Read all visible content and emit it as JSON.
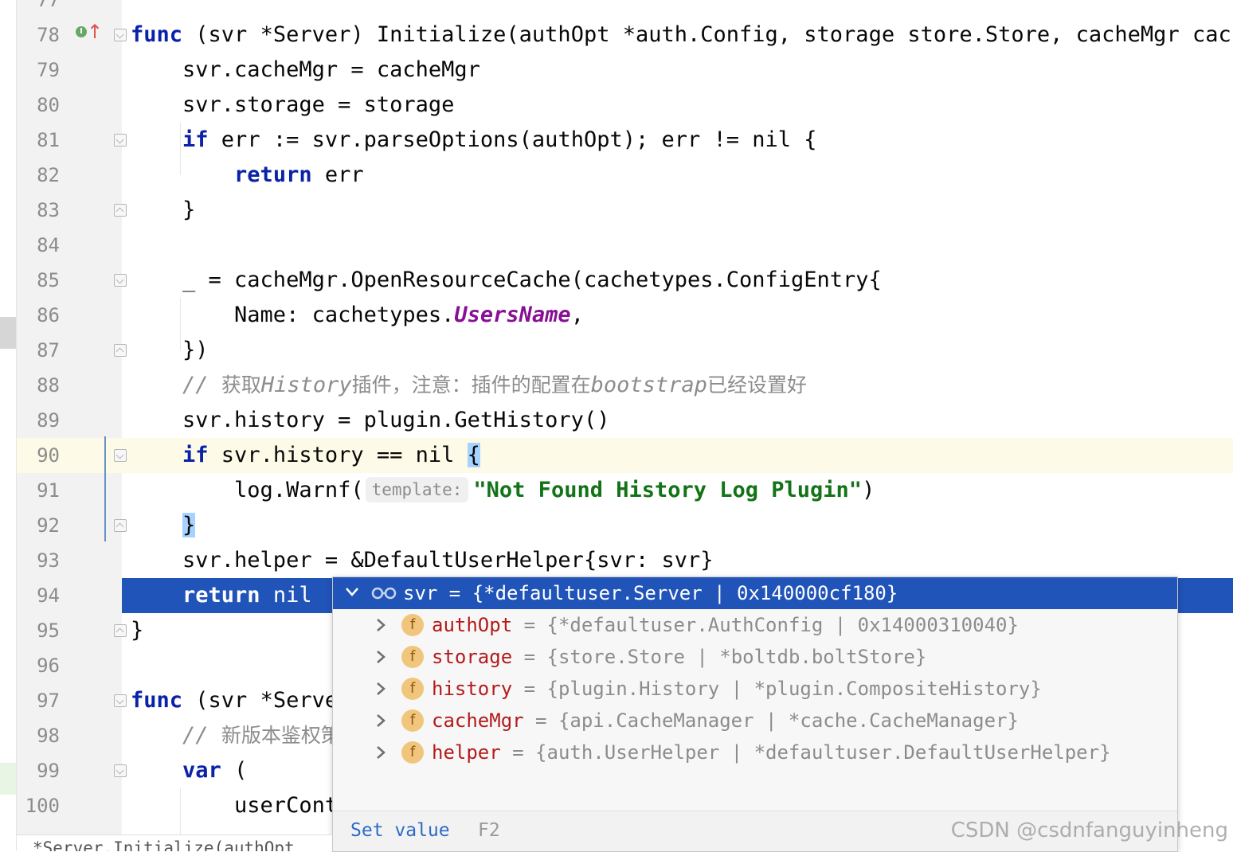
{
  "editor": {
    "lines": [
      {
        "num": "77"
      },
      {
        "num": "78",
        "tokens": [
          {
            "t": "func",
            "c": "kw"
          },
          {
            "t": " (svr *Server) Initialize(authOpt *auth.Config, storage store.Store, cacheMgr cache"
          }
        ]
      },
      {
        "num": "79",
        "tokens": [
          {
            "t": "    svr.cacheMgr = cacheMgr"
          }
        ]
      },
      {
        "num": "80",
        "tokens": [
          {
            "t": "    svr.storage = storage"
          }
        ]
      },
      {
        "num": "81",
        "tokens": [
          {
            "t": "    "
          },
          {
            "t": "if",
            "c": "kw"
          },
          {
            "t": " err := svr.parseOptions(authOpt); err != nil {"
          }
        ]
      },
      {
        "num": "82",
        "tokens": [
          {
            "t": "        "
          },
          {
            "t": "return",
            "c": "kw"
          },
          {
            "t": " err"
          }
        ]
      },
      {
        "num": "83",
        "tokens": [
          {
            "t": "    }"
          }
        ]
      },
      {
        "num": "84",
        "tokens": []
      },
      {
        "num": "85",
        "tokens": [
          {
            "t": "    _ = cacheMgr.OpenResourceCache(cachetypes.ConfigEntry{"
          }
        ]
      },
      {
        "num": "86",
        "tokens": [
          {
            "t": "        Name: cachetypes."
          },
          {
            "t": "UsersName",
            "c": "const"
          },
          {
            "t": ","
          }
        ]
      },
      {
        "num": "87",
        "tokens": [
          {
            "t": "    })"
          }
        ]
      },
      {
        "num": "88",
        "tokens": [
          {
            "t": "    "
          },
          {
            "t": "// ",
            "c": "cmt"
          },
          {
            "t": "获取",
            "c": "cmt-cn"
          },
          {
            "t": "History",
            "c": "cmt"
          },
          {
            "t": "插件，注意：插件的配置在",
            "c": "cmt-cn"
          },
          {
            "t": "bootstrap",
            "c": "cmt"
          },
          {
            "t": "已经设置好",
            "c": "cmt-cn"
          }
        ]
      },
      {
        "num": "89",
        "tokens": [
          {
            "t": "    svr.history = plugin.GetHistory()"
          }
        ]
      },
      {
        "num": "90",
        "tokens": [
          {
            "t": "    "
          },
          {
            "t": "if",
            "c": "kw"
          },
          {
            "t": " svr.history == nil "
          },
          {
            "t": "{",
            "c": "brace-hl"
          }
        ]
      },
      {
        "num": "91",
        "tokens": [
          {
            "t": "        log.Warnf("
          },
          {
            "t": "template:",
            "c": "hint"
          },
          {
            "t": "\"Not Found History Log Plugin\"",
            "c": "str"
          },
          {
            "t": ")"
          }
        ]
      },
      {
        "num": "92",
        "tokens": [
          {
            "t": "    "
          },
          {
            "t": "}",
            "c": "brace-hl"
          }
        ]
      },
      {
        "num": "93",
        "tokens": [
          {
            "t": "    svr.helper = &DefaultUserHelper{svr: svr}"
          }
        ]
      },
      {
        "num": "94",
        "tokens": [
          {
            "t": "    "
          },
          {
            "t": "return",
            "c": "kw"
          },
          {
            "t": " nil"
          }
        ]
      },
      {
        "num": "95",
        "tokens": [
          {
            "t": "}"
          }
        ]
      },
      {
        "num": "96",
        "tokens": []
      },
      {
        "num": "97",
        "tokens": [
          {
            "t": "func",
            "c": "kw"
          },
          {
            "t": " (svr *Serve"
          }
        ]
      },
      {
        "num": "98",
        "tokens": [
          {
            "t": "    "
          },
          {
            "t": "// ",
            "c": "cmt"
          },
          {
            "t": "新版本鉴权策",
            "c": "cmt-cn"
          }
        ]
      },
      {
        "num": "99",
        "tokens": [
          {
            "t": "    "
          },
          {
            "t": "var",
            "c": "kw"
          },
          {
            "t": " ("
          }
        ]
      },
      {
        "num": "100",
        "tokens": [
          {
            "t": "        userCont"
          }
        ]
      }
    ]
  },
  "debug_popup": {
    "header": "svr = {*defaultuser.Server | 0x140000cf180}",
    "fields": [
      {
        "icon": "f",
        "name": "authOpt",
        "value": " = {*defaultuser.AuthConfig | 0x14000310040}"
      },
      {
        "icon": "f",
        "name": "storage",
        "value": " = {store.Store | *boltdb.boltStore}"
      },
      {
        "icon": "f",
        "name": "history",
        "value": " = {plugin.History | *plugin.CompositeHistory}"
      },
      {
        "icon": "f",
        "name": "cacheMgr",
        "value": " = {api.CacheManager | *cache.CacheManager}"
      },
      {
        "icon": "f",
        "name": "helper",
        "value": " = {auth.UserHelper | *defaultuser.DefaultUserHelper}"
      }
    ],
    "set_value_label": "Set value",
    "set_value_shortcut": "F2"
  },
  "breadcrumb": "*Server.Initialize(authOpt",
  "watermark": "CSDN @csdnfanguyinheng",
  "icons": {
    "gutter_implements": "implements-icon",
    "gutter_arrow": "go-to-super-icon"
  }
}
